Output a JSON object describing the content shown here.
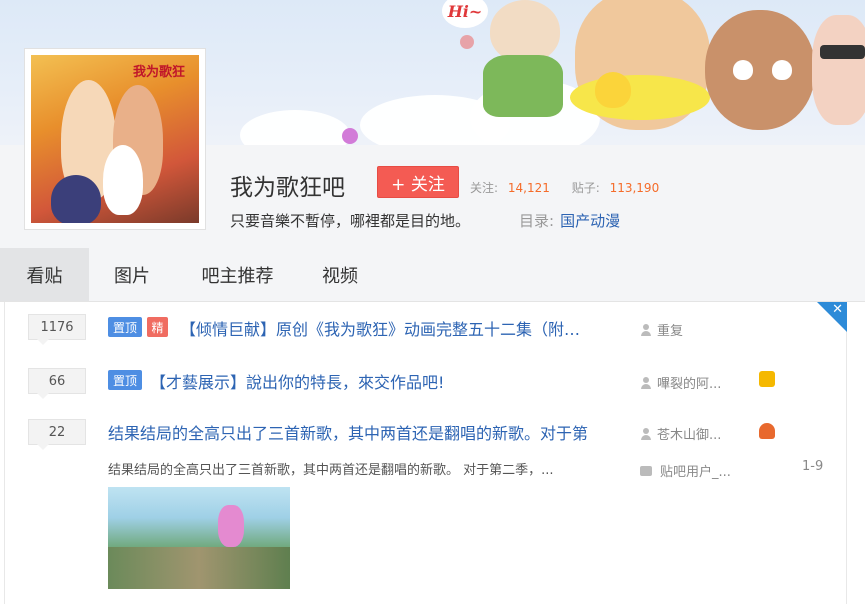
{
  "banner": {
    "hi_text": "Hi~"
  },
  "cover": {
    "title": "我为歌狂"
  },
  "bar": {
    "name": "我为歌狂吧",
    "follow_label": "+ 关注",
    "followers_label": "关注:",
    "followers_count": "14,121",
    "posts_label": "贴子:",
    "posts_count": "113,190",
    "slogan": "只要音樂不暫停，哪裡都是目的地。",
    "catalog_label": "目录:",
    "catalog_value": "国产动漫"
  },
  "tabs": [
    {
      "label": "看贴",
      "active": true
    },
    {
      "label": "图片",
      "active": false
    },
    {
      "label": "吧主推荐",
      "active": false
    },
    {
      "label": "视频",
      "active": false
    }
  ],
  "threads": [
    {
      "replies": "1176",
      "tags": [
        "置顶",
        "精"
      ],
      "title": "【倾情巨献】原创《我为歌狂》动画完整五十二集（附…",
      "author": "重复"
    },
    {
      "replies": "66",
      "tags": [
        "置顶"
      ],
      "title": "【才藝展示】說出你的特長，來交作品吧!",
      "author": "嗶裂的阿..."
    },
    {
      "replies": "22",
      "tags": [],
      "title": "结果结局的全高只出了三首新歌，其中两首还是翻唱的新歌。对于第",
      "author": "苍木山御...",
      "abstract": "结果结局的全高只出了三首新歌，其中两首还是翻唱的新歌。 对于第二季，...",
      "last_replier": "贴吧用户_...",
      "pages": "1-9"
    }
  ],
  "colors": {
    "accent": "#2d64b3",
    "follow": "#f45b53",
    "stat_number": "#f56c2a",
    "top_tag": "#4e8ee3",
    "good_tag": "#f06c61"
  }
}
